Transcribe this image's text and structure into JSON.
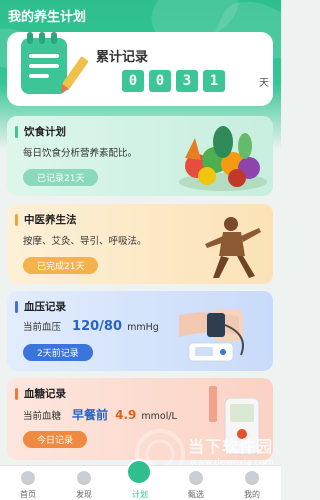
{
  "header": {
    "title": "我的养生计划"
  },
  "summary": {
    "title": "累计记录",
    "digits": [
      "0",
      "0",
      "3",
      "1"
    ],
    "unit": "天"
  },
  "cards": [
    {
      "title": "饮食计划",
      "desc": "每日饮食分析营养素配比。",
      "button": "已记录21天",
      "accent": "#3cc597",
      "button_color": "#8ad9bb"
    },
    {
      "title": "中医养生法",
      "desc": "按摩、艾灸、导引、呼吸法。",
      "button": "已完成21天",
      "accent": "#f2a537",
      "button_color": "#f4b24d"
    },
    {
      "title": "血压记录",
      "label": "当前血压",
      "value": "120/80",
      "unit": "mmHg",
      "button": "2天前记录",
      "accent": "#3a74dd",
      "button_color": "#3a74dd"
    },
    {
      "title": "血糖记录",
      "label": "当前血糖",
      "period": "早餐前",
      "value": "4.9",
      "unit": "mmol/L",
      "button": "今日记录",
      "accent": "#ef7a3a",
      "button_color": "#f08a42"
    }
  ],
  "watermark": {
    "text": "当下软件园",
    "url": "www.downxia.com"
  },
  "tabbar": {
    "items": [
      "首页",
      "发现",
      "计划",
      "甄选",
      "我的"
    ],
    "active": "计划",
    "active_color": "#2fbf8f"
  }
}
